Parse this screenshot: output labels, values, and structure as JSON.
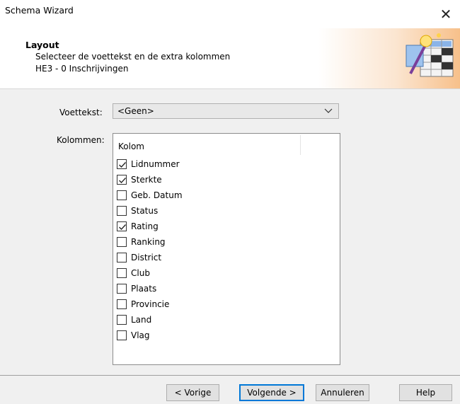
{
  "window": {
    "title": "Schema Wizard",
    "close_glyph": "✕"
  },
  "header": {
    "title": "Layout",
    "subtitle": "Selecteer de voettekst en de extra kolommen",
    "subtitle2": "HE3 - 0 Inschrijvingen",
    "icon": "wizard-table-icon"
  },
  "form": {
    "voettekst_label": "Voettekst:",
    "voettekst_value": "<Geen>",
    "kolommen_label": "Kolommen:"
  },
  "list": {
    "column_header": "Kolom",
    "items": [
      {
        "label": "Lidnummer",
        "checked": true
      },
      {
        "label": "Sterkte",
        "checked": true
      },
      {
        "label": "Geb. Datum",
        "checked": false
      },
      {
        "label": "Status",
        "checked": false
      },
      {
        "label": "Rating",
        "checked": true
      },
      {
        "label": "Ranking",
        "checked": false
      },
      {
        "label": "District",
        "checked": false
      },
      {
        "label": "Club",
        "checked": false
      },
      {
        "label": "Plaats",
        "checked": false
      },
      {
        "label": "Provincie",
        "checked": false
      },
      {
        "label": "Land",
        "checked": false
      },
      {
        "label": "Vlag",
        "checked": false
      }
    ]
  },
  "buttons": {
    "previous": "< Vorige",
    "next": "Volgende >",
    "cancel": "Annuleren",
    "help": "Help"
  }
}
